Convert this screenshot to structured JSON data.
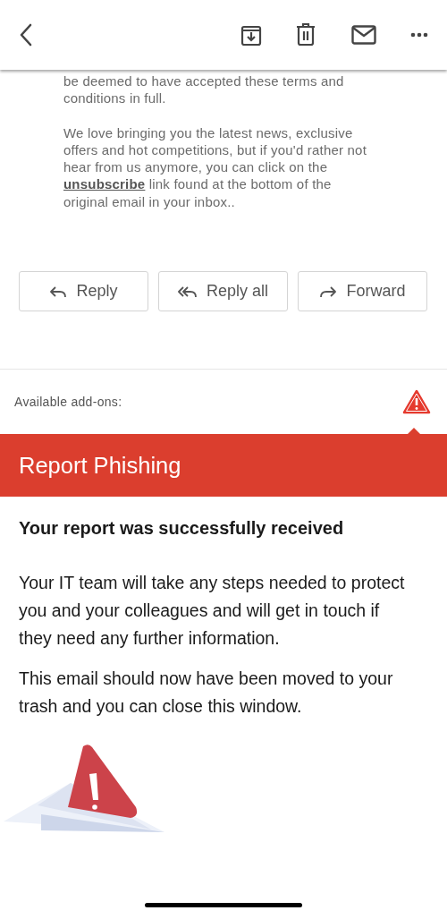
{
  "email_body": {
    "paragraph": "be deemed to have accepted these terms and conditions in full.",
    "unsubscribe_note": {
      "before": "We love bringing you the latest news, exclusive offers and hot competitions, but if you'd rather not hear from us anymore, you can click on the",
      "link": "unsubscribe",
      "after": "link found at the bottom of the original email in your inbox.."
    }
  },
  "actions": [
    {
      "kind": "reply",
      "label": "Reply"
    },
    {
      "kind": "reply_all",
      "label": "Reply all"
    },
    {
      "kind": "forward",
      "label": "Forward"
    }
  ],
  "addons": {
    "label": "Available add-ons:"
  },
  "panel": {
    "title": "Report Phishing",
    "heading": "Your report was successfully received",
    "paragraphs": [
      "Your IT team will take any steps needed to protect you and your colleagues and will get in touch if they need any further information.",
      "This email should now have been moved to your trash and you can close this window."
    ]
  }
}
